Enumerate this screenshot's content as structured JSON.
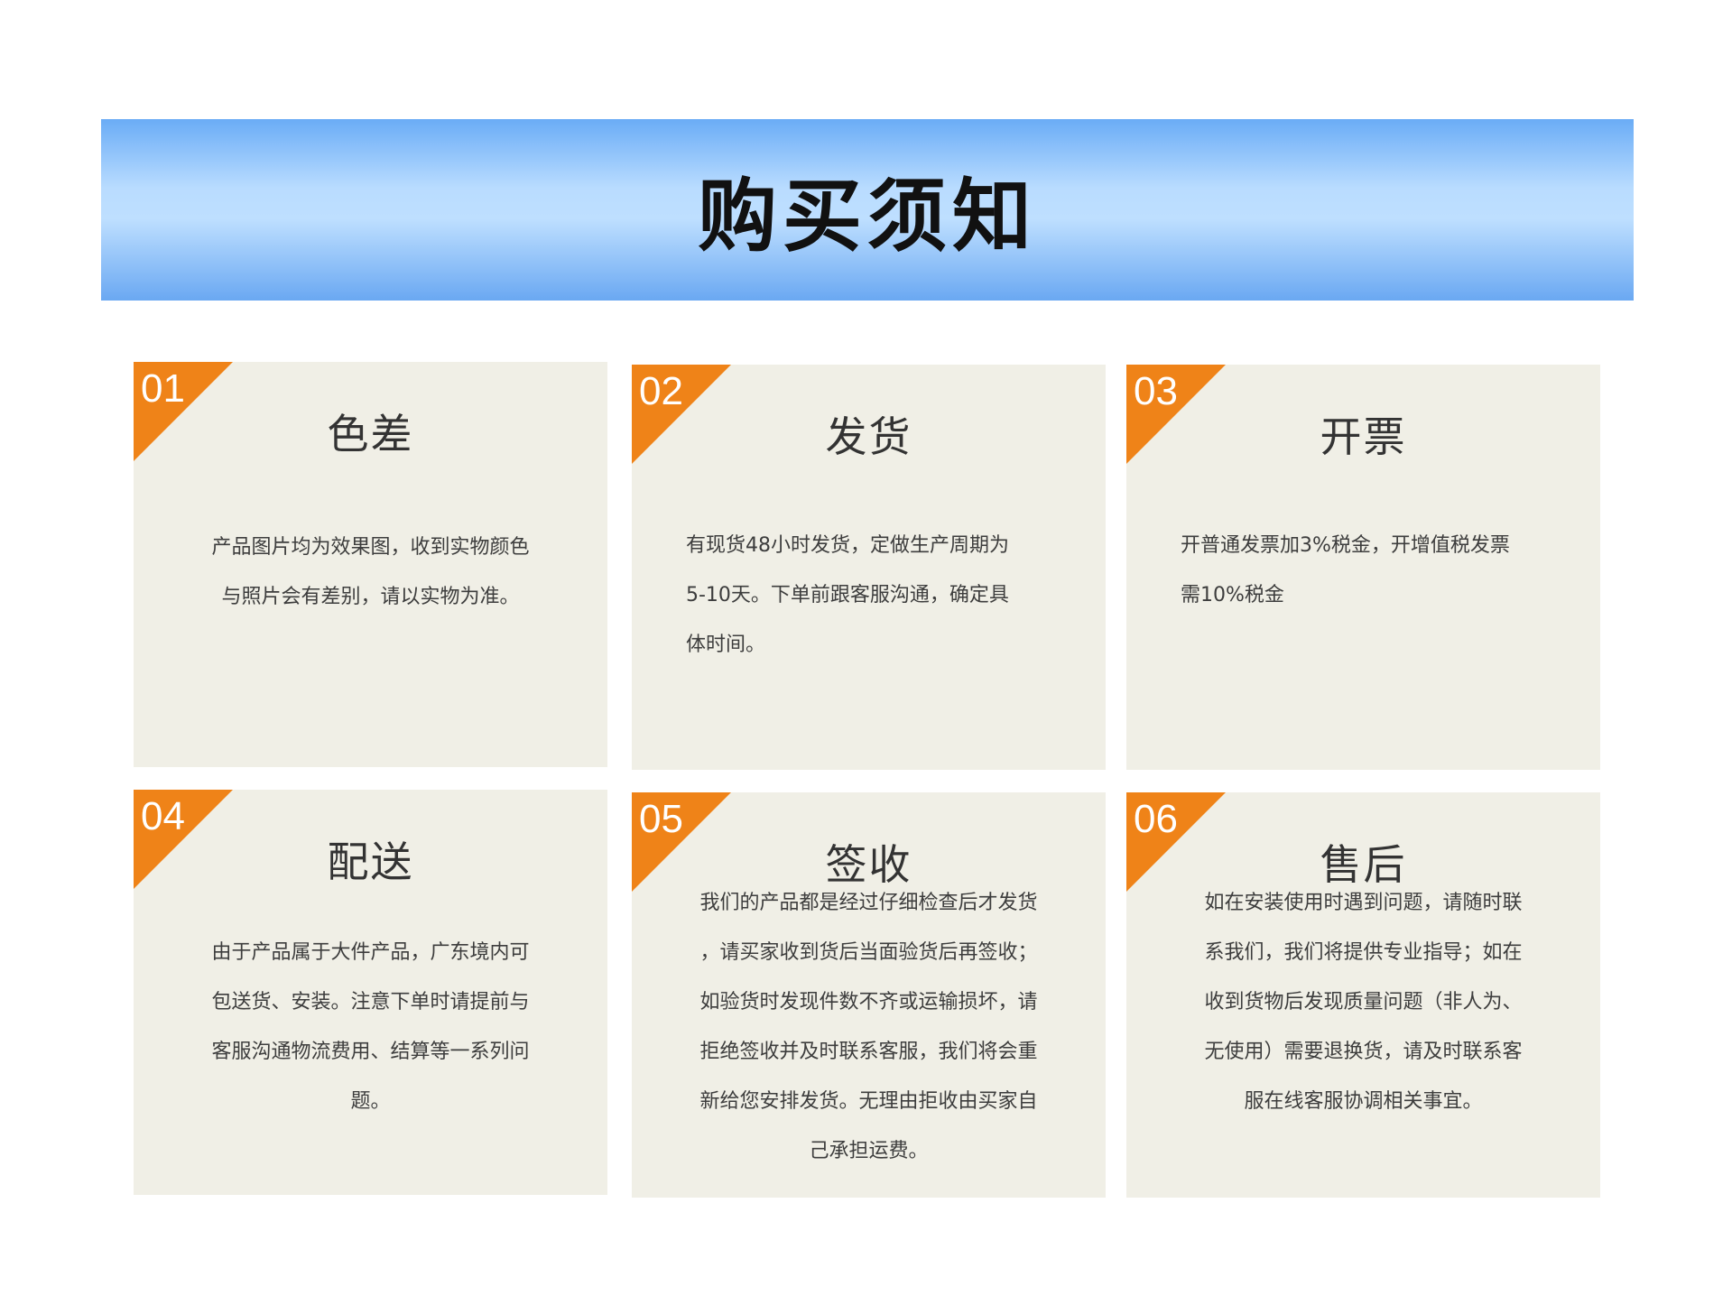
{
  "banner": {
    "title": "购买须知"
  },
  "colors": {
    "accent": "#ef8318",
    "card_background": "#f0efe6",
    "banner_gradient": [
      "#6aacf6",
      "#bedfff",
      "#6aa8f2"
    ]
  },
  "cards": [
    {
      "number": "01",
      "title": "色差",
      "lines": [
        "产品图片均为效果图，收到实物颜色",
        "与照片会有差别，请以实物为准。"
      ]
    },
    {
      "number": "02",
      "title": "发货",
      "lines": [
        "有现货48小时发货，定做生产周期为",
        "5-10天。下单前跟客服沟通，确定具",
        "体时间。"
      ]
    },
    {
      "number": "03",
      "title": "开票",
      "lines": [
        "开普通发票加3%税金，开增值税发票",
        "需10%税金"
      ]
    },
    {
      "number": "04",
      "title": "配送",
      "lines": [
        "由于产品属于大件产品，广东境内可",
        "包送货、安装。注意下单时请提前与",
        "客服沟通物流费用、结算等一系列问",
        "题。"
      ]
    },
    {
      "number": "05",
      "title": "签收",
      "lines": [
        "我们的产品都是经过仔细检查后才发货",
        "，请买家收到货后当面验货后再签收；",
        "如验货时发现件数不齐或运输损坏，请",
        "拒绝签收并及时联系客服，我们将会重",
        "新给您安排发货。无理由拒收由买家自",
        "己承担运费。"
      ]
    },
    {
      "number": "06",
      "title": "售后",
      "lines": [
        "如在安装使用时遇到问题，请随时联",
        "系我们，我们将提供专业指导；如在",
        "收到货物后发现质量问题（非人为、",
        "无使用）需要退换货，请及时联系客",
        "服在线客服协调相关事宜。"
      ]
    }
  ]
}
